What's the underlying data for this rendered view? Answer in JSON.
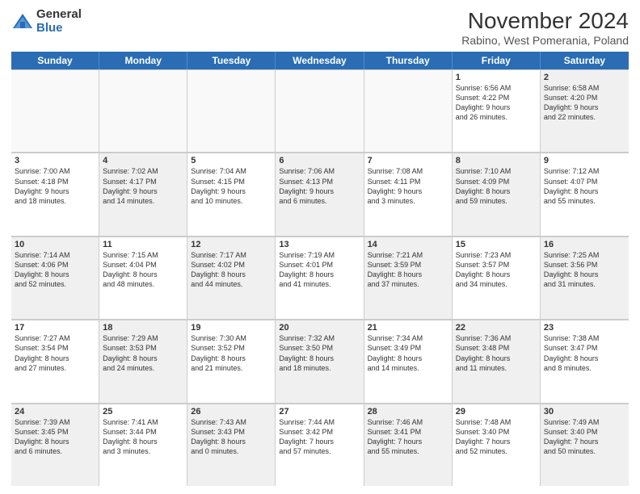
{
  "logo": {
    "general": "General",
    "blue": "Blue"
  },
  "title": "November 2024",
  "location": "Rabino, West Pomerania, Poland",
  "days": [
    "Sunday",
    "Monday",
    "Tuesday",
    "Wednesday",
    "Thursday",
    "Friday",
    "Saturday"
  ],
  "weeks": [
    [
      {
        "day": "",
        "info": "",
        "empty": true
      },
      {
        "day": "",
        "info": "",
        "empty": true
      },
      {
        "day": "",
        "info": "",
        "empty": true
      },
      {
        "day": "",
        "info": "",
        "empty": true
      },
      {
        "day": "",
        "info": "",
        "empty": true
      },
      {
        "day": "1",
        "info": "Sunrise: 6:56 AM\nSunset: 4:22 PM\nDaylight: 9 hours\nand 26 minutes.",
        "empty": false
      },
      {
        "day": "2",
        "info": "Sunrise: 6:58 AM\nSunset: 4:20 PM\nDaylight: 9 hours\nand 22 minutes.",
        "empty": false,
        "shaded": true
      }
    ],
    [
      {
        "day": "3",
        "info": "Sunrise: 7:00 AM\nSunset: 4:18 PM\nDaylight: 9 hours\nand 18 minutes.",
        "empty": false
      },
      {
        "day": "4",
        "info": "Sunrise: 7:02 AM\nSunset: 4:17 PM\nDaylight: 9 hours\nand 14 minutes.",
        "empty": false,
        "shaded": true
      },
      {
        "day": "5",
        "info": "Sunrise: 7:04 AM\nSunset: 4:15 PM\nDaylight: 9 hours\nand 10 minutes.",
        "empty": false
      },
      {
        "day": "6",
        "info": "Sunrise: 7:06 AM\nSunset: 4:13 PM\nDaylight: 9 hours\nand 6 minutes.",
        "empty": false,
        "shaded": true
      },
      {
        "day": "7",
        "info": "Sunrise: 7:08 AM\nSunset: 4:11 PM\nDaylight: 9 hours\nand 3 minutes.",
        "empty": false
      },
      {
        "day": "8",
        "info": "Sunrise: 7:10 AM\nSunset: 4:09 PM\nDaylight: 8 hours\nand 59 minutes.",
        "empty": false,
        "shaded": true
      },
      {
        "day": "9",
        "info": "Sunrise: 7:12 AM\nSunset: 4:07 PM\nDaylight: 8 hours\nand 55 minutes.",
        "empty": false
      }
    ],
    [
      {
        "day": "10",
        "info": "Sunrise: 7:14 AM\nSunset: 4:06 PM\nDaylight: 8 hours\nand 52 minutes.",
        "empty": false,
        "shaded": true
      },
      {
        "day": "11",
        "info": "Sunrise: 7:15 AM\nSunset: 4:04 PM\nDaylight: 8 hours\nand 48 minutes.",
        "empty": false
      },
      {
        "day": "12",
        "info": "Sunrise: 7:17 AM\nSunset: 4:02 PM\nDaylight: 8 hours\nand 44 minutes.",
        "empty": false,
        "shaded": true
      },
      {
        "day": "13",
        "info": "Sunrise: 7:19 AM\nSunset: 4:01 PM\nDaylight: 8 hours\nand 41 minutes.",
        "empty": false
      },
      {
        "day": "14",
        "info": "Sunrise: 7:21 AM\nSunset: 3:59 PM\nDaylight: 8 hours\nand 37 minutes.",
        "empty": false,
        "shaded": true
      },
      {
        "day": "15",
        "info": "Sunrise: 7:23 AM\nSunset: 3:57 PM\nDaylight: 8 hours\nand 34 minutes.",
        "empty": false
      },
      {
        "day": "16",
        "info": "Sunrise: 7:25 AM\nSunset: 3:56 PM\nDaylight: 8 hours\nand 31 minutes.",
        "empty": false,
        "shaded": true
      }
    ],
    [
      {
        "day": "17",
        "info": "Sunrise: 7:27 AM\nSunset: 3:54 PM\nDaylight: 8 hours\nand 27 minutes.",
        "empty": false
      },
      {
        "day": "18",
        "info": "Sunrise: 7:29 AM\nSunset: 3:53 PM\nDaylight: 8 hours\nand 24 minutes.",
        "empty": false,
        "shaded": true
      },
      {
        "day": "19",
        "info": "Sunrise: 7:30 AM\nSunset: 3:52 PM\nDaylight: 8 hours\nand 21 minutes.",
        "empty": false
      },
      {
        "day": "20",
        "info": "Sunrise: 7:32 AM\nSunset: 3:50 PM\nDaylight: 8 hours\nand 18 minutes.",
        "empty": false,
        "shaded": true
      },
      {
        "day": "21",
        "info": "Sunrise: 7:34 AM\nSunset: 3:49 PM\nDaylight: 8 hours\nand 14 minutes.",
        "empty": false
      },
      {
        "day": "22",
        "info": "Sunrise: 7:36 AM\nSunset: 3:48 PM\nDaylight: 8 hours\nand 11 minutes.",
        "empty": false,
        "shaded": true
      },
      {
        "day": "23",
        "info": "Sunrise: 7:38 AM\nSunset: 3:47 PM\nDaylight: 8 hours\nand 8 minutes.",
        "empty": false
      }
    ],
    [
      {
        "day": "24",
        "info": "Sunrise: 7:39 AM\nSunset: 3:45 PM\nDaylight: 8 hours\nand 6 minutes.",
        "empty": false,
        "shaded": true
      },
      {
        "day": "25",
        "info": "Sunrise: 7:41 AM\nSunset: 3:44 PM\nDaylight: 8 hours\nand 3 minutes.",
        "empty": false
      },
      {
        "day": "26",
        "info": "Sunrise: 7:43 AM\nSunset: 3:43 PM\nDaylight: 8 hours\nand 0 minutes.",
        "empty": false,
        "shaded": true
      },
      {
        "day": "27",
        "info": "Sunrise: 7:44 AM\nSunset: 3:42 PM\nDaylight: 7 hours\nand 57 minutes.",
        "empty": false
      },
      {
        "day": "28",
        "info": "Sunrise: 7:46 AM\nSunset: 3:41 PM\nDaylight: 7 hours\nand 55 minutes.",
        "empty": false,
        "shaded": true
      },
      {
        "day": "29",
        "info": "Sunrise: 7:48 AM\nSunset: 3:40 PM\nDaylight: 7 hours\nand 52 minutes.",
        "empty": false
      },
      {
        "day": "30",
        "info": "Sunrise: 7:49 AM\nSunset: 3:40 PM\nDaylight: 7 hours\nand 50 minutes.",
        "empty": false,
        "shaded": true
      }
    ]
  ]
}
